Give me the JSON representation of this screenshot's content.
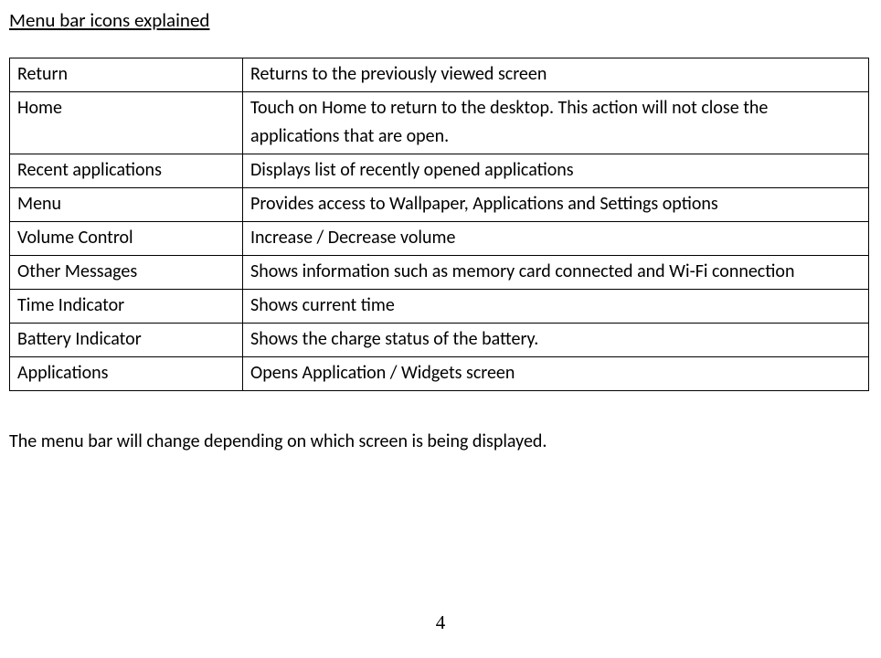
{
  "heading": "Menu bar icons explained",
  "rows": [
    {
      "name": "Return",
      "desc": "Returns to the previously viewed screen"
    },
    {
      "name": "Home",
      "desc": "Touch on Home to return to the desktop. This action will not close the applications that are open."
    },
    {
      "name": "Recent applications",
      "desc": "Displays list of recently opened applications"
    },
    {
      "name": "Menu",
      "desc": "Provides access to Wallpaper, Applications and Settings options"
    },
    {
      "name": "Volume Control",
      "desc": "Increase / Decrease volume"
    },
    {
      "name": "Other Messages",
      "desc": "Shows information such as memory card connected and Wi-Fi connection"
    },
    {
      "name": "Time Indicator",
      "desc": "Shows current time"
    },
    {
      "name": "Battery Indicator",
      "desc": "Shows the charge status of the battery."
    },
    {
      "name": "Applications",
      "desc": "Opens Application / Widgets screen"
    }
  ],
  "footer_para": "The menu bar will change depending on which screen is being displayed.",
  "page_number": "4"
}
